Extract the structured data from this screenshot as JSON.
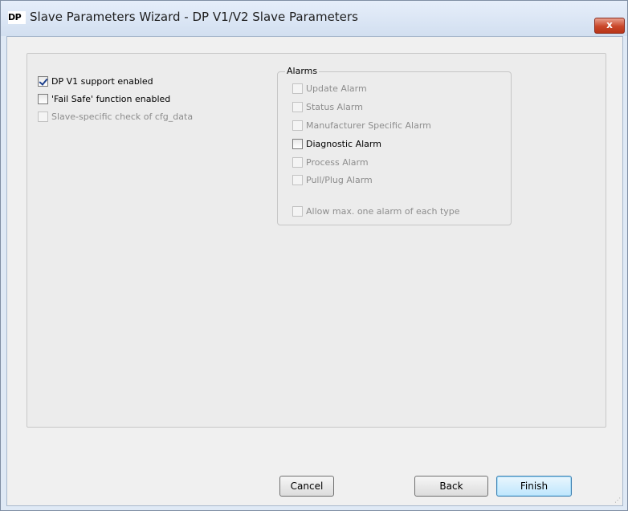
{
  "window": {
    "icon_text": "DP",
    "title": "Slave Parameters Wizard - DP V1/V2 Slave Parameters",
    "close_label": "x"
  },
  "options": [
    {
      "label": "DP V1 support enabled",
      "checked": true,
      "enabled": true
    },
    {
      "label": "'Fail Safe' function enabled",
      "checked": false,
      "enabled": true
    },
    {
      "label": "Slave-specific check of cfg_data",
      "checked": false,
      "enabled": false
    }
  ],
  "alarms": {
    "title": "Alarms",
    "items": [
      {
        "label": "Update Alarm",
        "checked": false,
        "enabled": false
      },
      {
        "label": "Status Alarm",
        "checked": false,
        "enabled": false
      },
      {
        "label": "Manufacturer Specific Alarm",
        "checked": false,
        "enabled": false
      },
      {
        "label": "Diagnostic Alarm",
        "checked": false,
        "enabled": true
      },
      {
        "label": "Process Alarm",
        "checked": false,
        "enabled": false
      },
      {
        "label": "Pull/Plug Alarm",
        "checked": false,
        "enabled": false
      }
    ],
    "max_one": {
      "label": "Allow max. one alarm of each type",
      "checked": false,
      "enabled": false
    }
  },
  "buttons": {
    "cancel": "Cancel",
    "back": "Back",
    "finish": "Finish"
  }
}
